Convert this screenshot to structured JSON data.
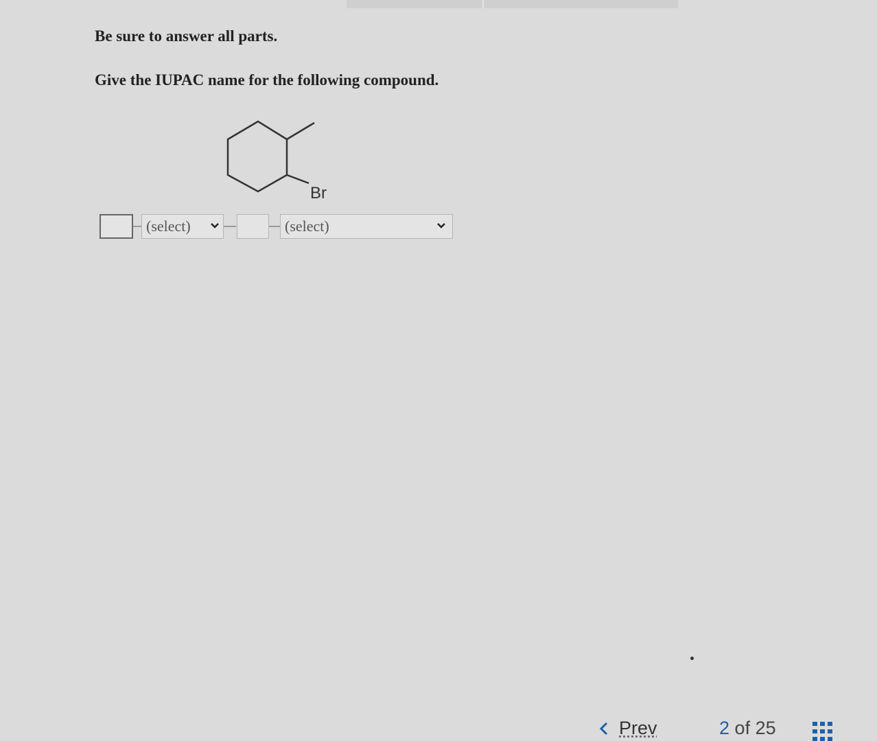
{
  "instruction": "Be sure to answer all parts.",
  "question": "Give the IUPAC name for the following compound.",
  "molecule": {
    "substituent_label": "Br"
  },
  "answer": {
    "locant_1_value": "",
    "select_1_value": "(select)",
    "locant_2_value": "",
    "select_2_value": "(select)"
  },
  "footer": {
    "prev_label": "Prev",
    "page_current": "2",
    "page_of": "of",
    "page_total": "25"
  },
  "colors": {
    "link_blue": "#1e5fa8",
    "page_background": "#dcdbdb"
  }
}
